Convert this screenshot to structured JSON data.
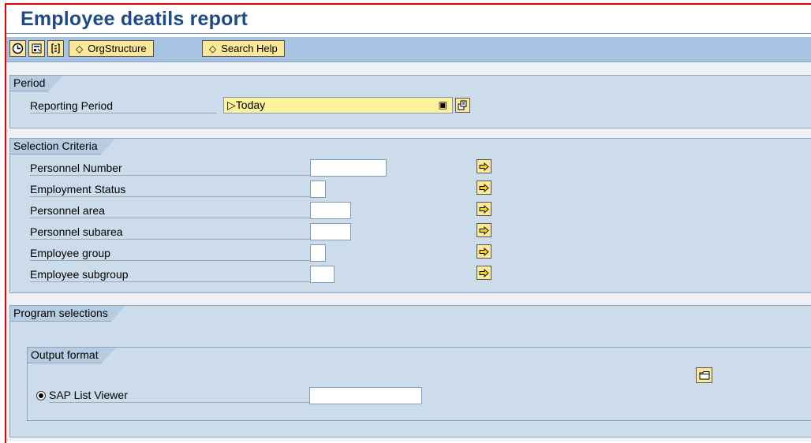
{
  "window": {
    "title": "Employee deatils report"
  },
  "toolbar": {
    "icons": [
      "execute-clock-icon",
      "variant-icon",
      "selection-options-icon"
    ],
    "org_structure_label": "OrgStructure",
    "search_help_label": "Search Help"
  },
  "period": {
    "group_title": "Period",
    "reporting_period_label": "Reporting Period",
    "reporting_period_value": "Today"
  },
  "selection": {
    "group_title": "Selection Criteria",
    "fields": [
      {
        "label": "Personnel Number",
        "value": ""
      },
      {
        "label": "Employment Status",
        "value": ""
      },
      {
        "label": "Personnel area",
        "value": ""
      },
      {
        "label": "Personnel subarea",
        "value": ""
      },
      {
        "label": "Employee group",
        "value": ""
      },
      {
        "label": "Employee subgroup",
        "value": ""
      }
    ]
  },
  "program": {
    "group_title": "Program selections",
    "output_format_title": "Output format",
    "list_viewer_label": "SAP List Viewer",
    "list_viewer_value": "",
    "list_viewer_selected": true
  },
  "colors": {
    "title": "#1e4a86",
    "toolbar": "#a8c4e2",
    "group_bg": "#cddcea",
    "button_bg": "#fde89a",
    "highlight_field": "#fdf19c",
    "frame_border": "#e00000"
  }
}
